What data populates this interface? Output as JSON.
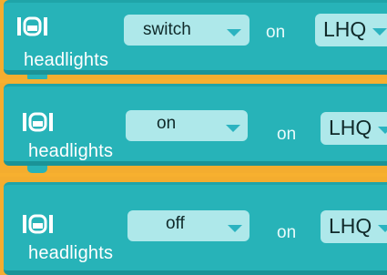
{
  "blocks": [
    {
      "action": "switch",
      "connector": "on",
      "target": "LHQ",
      "name": "headlights",
      "icon": "headlight-icon"
    },
    {
      "action": "on",
      "connector": "on",
      "target": "LHQ",
      "name": "headlights",
      "icon": "headlight-icon"
    },
    {
      "action": "off",
      "connector": "on",
      "target": "LHQ",
      "name": "headlights",
      "icon": "headlight-icon"
    }
  ],
  "colors": {
    "block": "#27b3b8",
    "dropdown": "#aee8ea",
    "workspace": "#f4ad2f"
  }
}
